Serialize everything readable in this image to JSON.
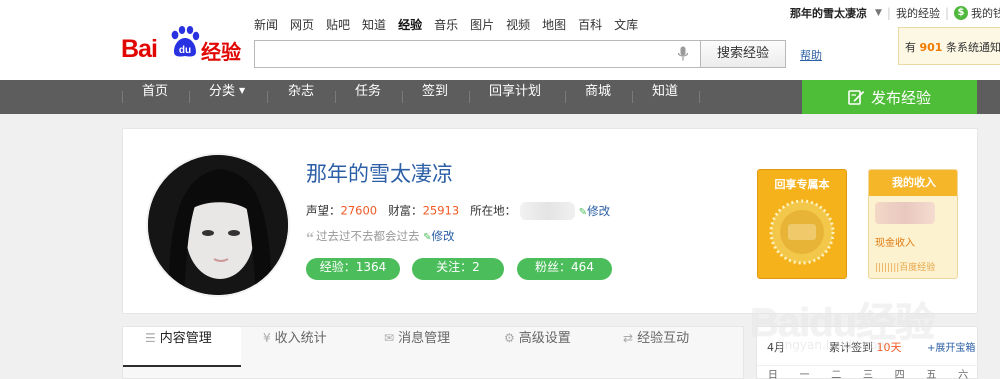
{
  "logo": {
    "brand": "Bai",
    "paw_text": "du",
    "product": "经验"
  },
  "top_nav": [
    "新闻",
    "网页",
    "贴吧",
    "知道",
    "经验",
    "音乐",
    "图片",
    "视频",
    "地图",
    "百科",
    "文库"
  ],
  "top_nav_active": "经验",
  "search": {
    "value": "",
    "button": "搜索经验",
    "help": "帮助"
  },
  "user_bar": {
    "username": "那年的雪太凄凉",
    "my_experience": "我的经验",
    "my_wallet": "我的钱"
  },
  "notice": {
    "prefix": "有",
    "count": "901",
    "suffix": "条系统通知"
  },
  "main_nav": [
    "首页",
    "分类",
    "杂志",
    "任务",
    "签到",
    "回享计划",
    "商城",
    "知道"
  ],
  "publish": "发布经验",
  "profile": {
    "name": "那年的雪太凄凉",
    "reputation_label": "声望：",
    "reputation": "27600",
    "wealth_label": "财富：",
    "wealth": "25913",
    "location_label": "所在地：",
    "edit": "修改",
    "motto": "过去过不去都会过去",
    "pills": [
      "经验：1364",
      "关注：2",
      "粉丝：464"
    ]
  },
  "badges": {
    "exclusive": "回享专属本",
    "income_title": "我的收入",
    "income_cash": "现金收入",
    "income_footer": "百度经验"
  },
  "tabs": [
    "内容管理",
    "收入统计",
    "消息管理",
    "高级设置",
    "经验互动"
  ],
  "tab_icons": [
    "list-icon",
    "yen-icon",
    "mail-icon",
    "gear-icon",
    "exchange-icon"
  ],
  "calendar": {
    "month": "4月",
    "signed_prefix": "累计签到",
    "signed_days": "10天",
    "open_link": "展开宝箱",
    "weekdays": [
      "日",
      "一",
      "二",
      "三",
      "四",
      "五",
      "六"
    ]
  },
  "watermark": {
    "text": "Baidu经验",
    "url": "jingyan.baidu.com"
  },
  "colors": {
    "brand_red": "#e10601",
    "nav_bg": "#5d5d5d",
    "publish_green": "#4ebd37",
    "pill_green": "#4cbd5b",
    "link_blue": "#2d5fa6",
    "value_orange": "#f05a24"
  }
}
